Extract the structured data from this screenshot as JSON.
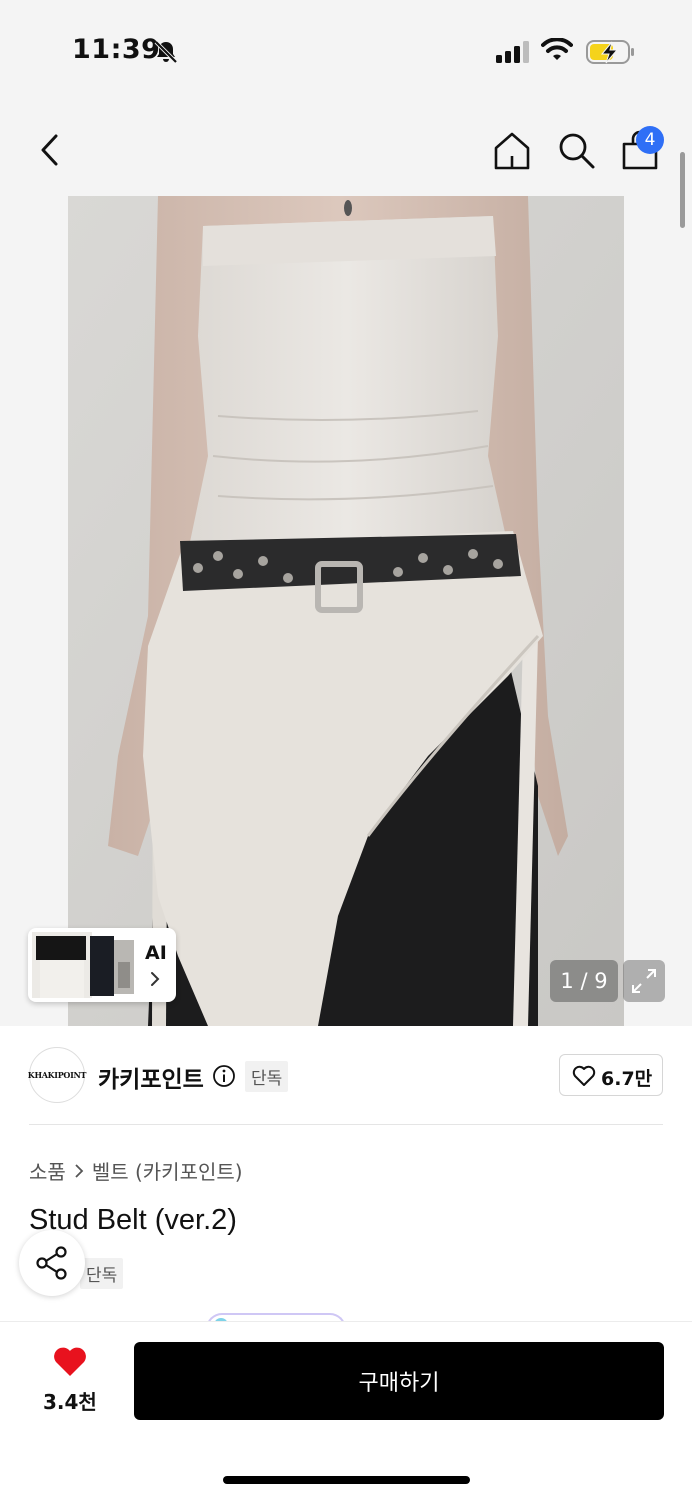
{
  "status_bar": {
    "time": "11:39",
    "icons": [
      "bell-slash-icon",
      "signal-icon",
      "wifi-icon",
      "battery-charging-icon"
    ]
  },
  "nav": {
    "icons": [
      "back-icon",
      "home-icon",
      "search-icon",
      "shopping-bag-icon"
    ],
    "cart_count": "4"
  },
  "gallery": {
    "ai_label": "AI",
    "page_counter": "1 / 9",
    "current_page": 1,
    "total_pages": 9
  },
  "brand": {
    "logo_text": "KHAKIPOINT",
    "name": "카키포인트",
    "exclusive_tag": "단독",
    "likes": "6.7만"
  },
  "breadcrumb": {
    "items": [
      "소품",
      "벨트 (카키포인트)"
    ]
  },
  "product": {
    "title": "Stud Belt (ver.2)",
    "exclusive_tag": "단독"
  },
  "bottom_bar": {
    "wish_count": "3.4천",
    "buy_label": "구매하기"
  },
  "colors": {
    "accent_blue": "#2f6ff6",
    "heart_red": "#e8121e",
    "buy_button": "#000000"
  }
}
